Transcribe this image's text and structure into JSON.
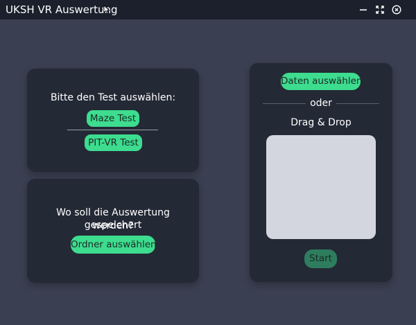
{
  "window": {
    "title": "UKSH VR Auswertung",
    "controls": [
      "minimize-icon",
      "maximize-icon",
      "close-icon"
    ]
  },
  "test_panel": {
    "prompt": "Bitte den Test auswählen:",
    "options": [
      "Maze Test",
      "PIT-VR Test"
    ]
  },
  "save_panel": {
    "prompt_line1": "Wo soll die Auswertung gespeichert",
    "prompt_line2": "werden?",
    "button_label": "Ordner auswählen"
  },
  "data_panel": {
    "select_button_label": "Daten auswählen",
    "separator_label": "oder",
    "drop_label": "Drag & Drop",
    "start_button_label": "Start"
  },
  "colors": {
    "background": "#3a3f51",
    "titlebar": "#1b202c",
    "panel": "#232935",
    "accent": "#3ddc8f",
    "accent_disabled": "#2e7d5e",
    "dropzone": "#d3d6de"
  }
}
